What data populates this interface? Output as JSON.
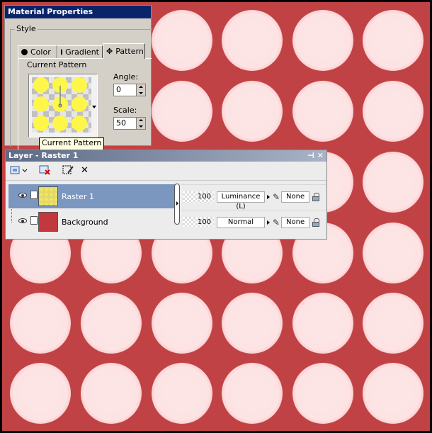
{
  "material_panel": {
    "title": "Material Properties",
    "style_group_label": "Style",
    "tabs": [
      {
        "label": "Color",
        "icon": "filled-circle-icon",
        "active": false
      },
      {
        "label": "Gradient",
        "icon": "half-circle-icon",
        "active": false
      },
      {
        "label": "Pattern",
        "icon": "pattern-icon",
        "active": true
      }
    ],
    "current_pattern_label": "Current Pattern",
    "angle_label": "Angle:",
    "angle_value": "0",
    "scale_label": "Scale:",
    "scale_value": "50",
    "tooltip": "Current Pattern"
  },
  "layer_panel": {
    "title": "Layer - Raster 1",
    "title_buttons": [
      "pin-icon",
      "close-icon"
    ],
    "toolbar": [
      "new-layer-icon",
      "delete-layer-icon",
      "edit-selection-icon",
      "close-x-icon"
    ],
    "layers": [
      {
        "name": "Raster 1",
        "opacity": "100",
        "blend_mode": "Luminance (L)",
        "mask": "None",
        "selected": true
      },
      {
        "name": "Background",
        "opacity": "100",
        "blend_mode": "Normal",
        "mask": "None",
        "selected": false
      }
    ]
  },
  "colors": {
    "canvas_background": "#c04244",
    "dot_fill": "#fde4e5",
    "pattern_dot": "#fff64a",
    "layer_selected": "#7b97c0"
  }
}
